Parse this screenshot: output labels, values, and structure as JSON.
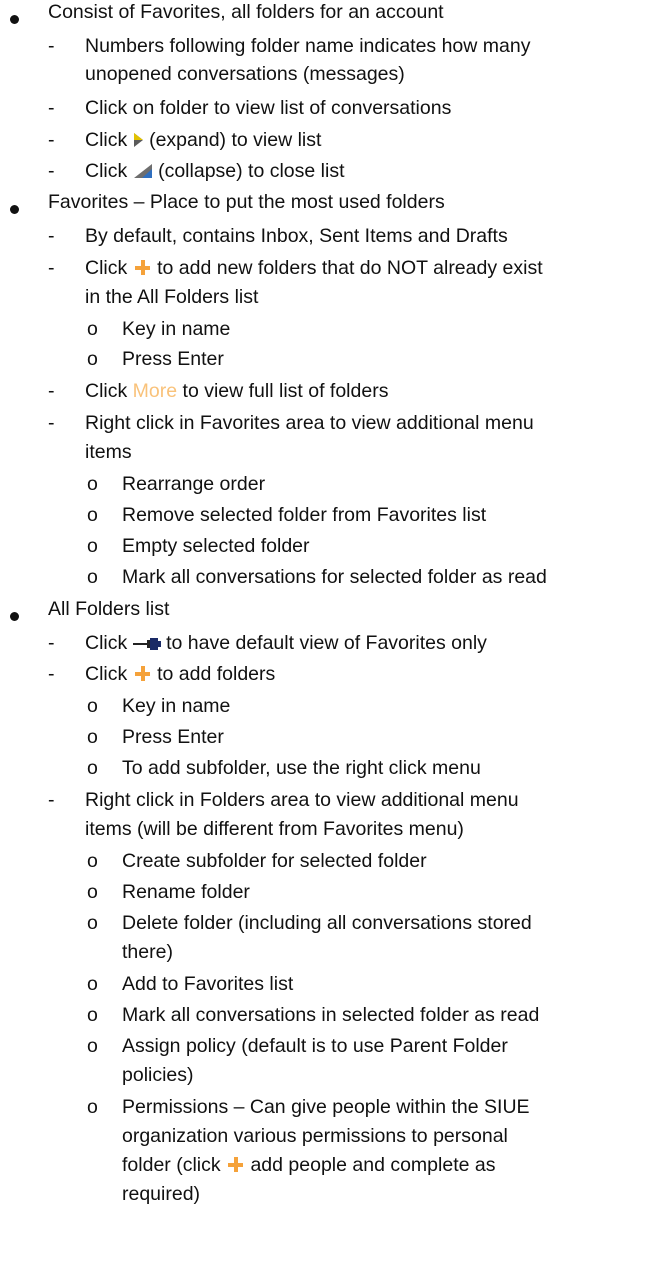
{
  "sections": [
    {
      "title": "Consist of Favorites, all folders for an account",
      "items": [
        {
          "lines": [
            "Numbers following folder name indicates how many",
            "unopened conversations (messages)"
          ]
        },
        {
          "lines": [
            "Click on folder to view list of conversations"
          ]
        },
        {
          "pre": "Click",
          "icon": "expand-arrow-icon",
          "post": "(expand) to view list"
        },
        {
          "pre": "Click",
          "icon": "collapse-arrow-icon",
          "post": "(collapse) to close list"
        }
      ]
    },
    {
      "title": "Favorites – Place to put the most used folders",
      "items": [
        {
          "lines": [
            "By default, contains Inbox, Sent Items and Drafts"
          ]
        },
        {
          "pre": "Click",
          "icon": "plus-icon",
          "post": "to add new folders that do NOT already exist",
          "line2": "in the All Folders list",
          "subitems": [
            "Key in name",
            "Press Enter"
          ]
        },
        {
          "pre": "Click",
          "more_label": "More",
          "post": "to view full list of folders"
        },
        {
          "lines": [
            "Right click in Favorites area to view additional menu",
            "items"
          ],
          "subitems": [
            "Rearrange order",
            "Remove selected folder from Favorites list",
            "Empty selected folder",
            "Mark all conversations for selected folder as read"
          ]
        }
      ]
    },
    {
      "title": "All Folders list",
      "items": [
        {
          "pre": "Click",
          "icon": "pin-icon",
          "post": "to have default view of Favorites only"
        },
        {
          "pre": "Click",
          "icon": "plus-icon",
          "post": "to add folders",
          "subitems": [
            "Key in name",
            "Press Enter",
            "To add subfolder, use the right click menu"
          ]
        },
        {
          "lines": [
            "Right click in Folders area to view additional menu",
            "items (will be different from Favorites menu)"
          ],
          "subitems": [
            "Create subfolder for selected folder",
            "Rename folder",
            "Delete folder (including all conversations stored",
            "there)",
            "Add to Favorites list",
            "Mark all conversations in selected folder as read",
            "Assign policy (default is to use Parent Folder",
            "policies)",
            "Permissions – Can give people within the SIUE",
            "organization various permissions to personal",
            "folder (click",
            "add people and complete as",
            "required)"
          ]
        }
      ]
    }
  ],
  "markers": {
    "level2": "-",
    "level3": "o"
  },
  "colors": {
    "accent_plus": "#f5a23a",
    "more_link": "#f9c27a"
  }
}
